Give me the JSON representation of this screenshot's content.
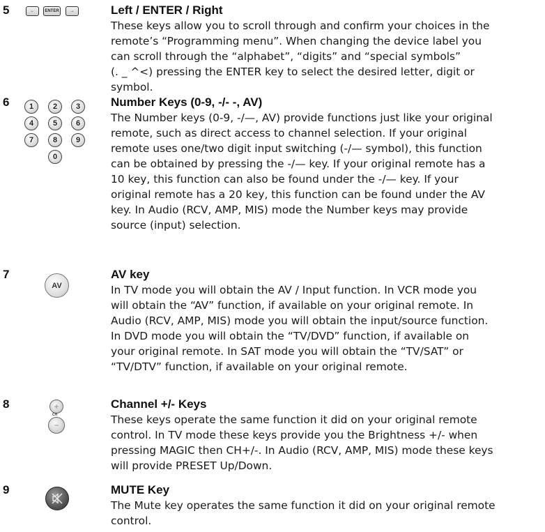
{
  "sections": [
    {
      "number": "5",
      "icon_labels": [
        "←",
        "ENTER",
        "→"
      ],
      "title": "Left / ENTER / Right",
      "lines": [
        "These keys allow you to scroll through and confirm your choices in the",
        "remote’s “Programming menu”. When changing the device label you",
        "can scroll  through the “alphabet”, “digits” and “special symbols”",
        "(. _ ^<) pressing the ENTER key to select the desired letter, digit or",
        "symbol."
      ]
    },
    {
      "number": "6",
      "icon_labels": [
        "1",
        "2",
        "3",
        "4",
        "5",
        "6",
        "7",
        "8",
        "9",
        "0"
      ],
      "title": "Number Keys (0-9, -/- -, AV)",
      "lines": [
        "The Number keys (0-9, -/—, AV) provide functions just like your original",
        "remote, such as direct access to channel selection. If your original",
        "remote uses one/two digit input switching (-/— symbol), this function",
        "can be obtained by pressing the -/— key. If your original remote has a",
        "10 key, this function can also be found under the -/— key. If your",
        "original remote has a 20 key, this function can be found under the AV",
        "key. In Audio (RCV, AMP, MIS) mode the Number keys may provide",
        "source (input) selection."
      ]
    },
    {
      "number": "7",
      "icon_labels": [
        "AV"
      ],
      "title": "AV key",
      "lines": [
        "In TV mode you will obtain the AV / Input function. In VCR mode you",
        "will obtain the “AV” function, if available on your original remote.  In",
        "Audio (RCV, AMP, MIS) mode you will obtain the input/source function.",
        "In DVD mode you will obtain the “TV/DVD” function, if available on",
        "your original remote. In SAT mode you will obtain the “TV/SAT” or",
        "“TV/DTV” function, if available on your original remote."
      ]
    },
    {
      "number": "8",
      "icon_labels": [
        "+",
        "CH",
        "−"
      ],
      "title": "Channel +/- Keys",
      "lines": [
        "These keys operate the same function it did on your original remote",
        "control. In TV mode these keys provide you the Brightness +/- when",
        "pressing MAGIC then CH+/-. In Audio (RCV, AMP, MIS) mode these keys",
        "will provide PRESET Up/Down."
      ]
    },
    {
      "number": "9",
      "icon_labels": [
        "mute-icon"
      ],
      "title": "MUTE Key",
      "lines": [
        "The Mute key operates the same function it did on your original remote",
        "control."
      ]
    }
  ]
}
